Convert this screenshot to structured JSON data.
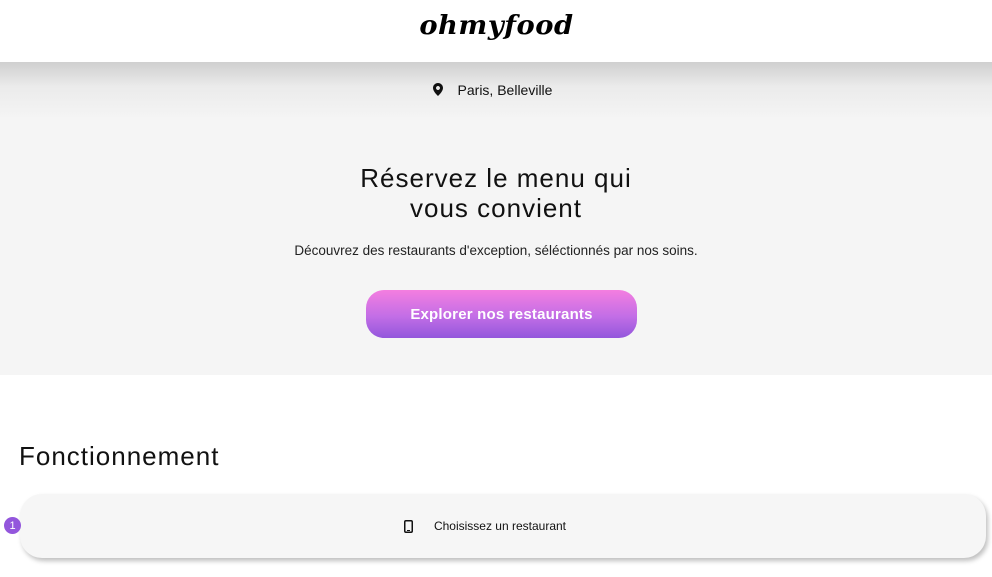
{
  "header": {
    "logo_text": "ohmyfood"
  },
  "location": {
    "icon": "location-pin-icon",
    "text": "Paris, Belleville"
  },
  "hero": {
    "title_line_1": "Réservez le menu qui",
    "title_line_2": "vous convient",
    "subtitle": "Découvrez des restaurants d'exception, séléctionnés par nos soins.",
    "cta_label": "Explorer nos restaurants"
  },
  "how_it_works": {
    "title": "Fonctionnement",
    "steps": [
      {
        "number": "1",
        "icon": "mobile-phone-icon",
        "label": "Choisissez un restaurant"
      }
    ]
  },
  "colors": {
    "accent_pink": "#f47ee0",
    "accent_purple": "#9356dc",
    "hero_background": "#f5f5f5"
  }
}
